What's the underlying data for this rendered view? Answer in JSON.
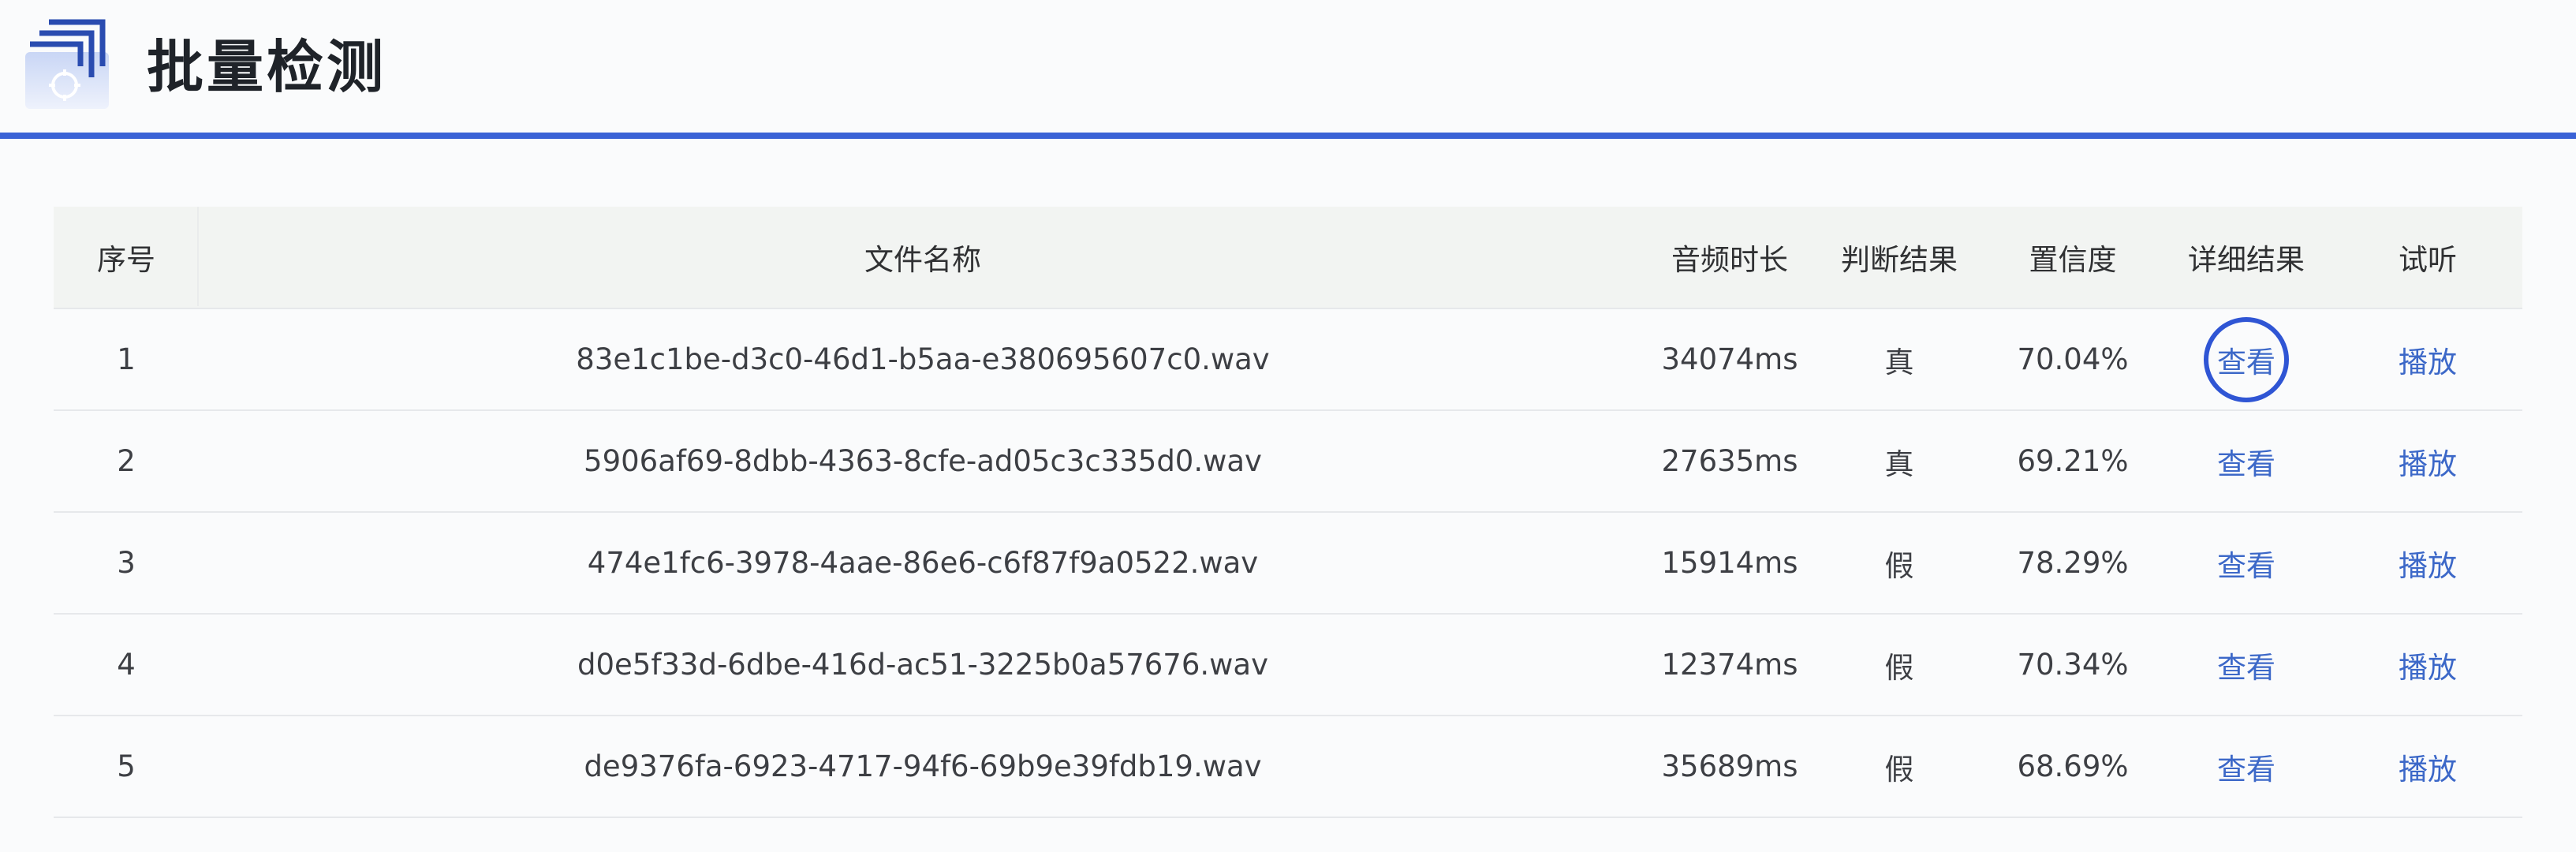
{
  "header": {
    "title": "批量检测",
    "logo_icon": "batch-detect-logo-icon"
  },
  "colors": {
    "accent": "#3a62d6",
    "link": "#3c68c8",
    "header_row_bg": "#f2f4f2"
  },
  "table": {
    "columns": [
      "序号",
      "文件名称",
      "音频时长",
      "判断结果",
      "置信度",
      "详细结果",
      "试听"
    ],
    "rows": [
      {
        "index": "1",
        "filename": "83e1c1be-d3c0-46d1-b5aa-e380695607c0.wav",
        "duration": "34074ms",
        "result": "真",
        "confidence": "70.04%",
        "detail": "查看",
        "play": "播放"
      },
      {
        "index": "2",
        "filename": "5906af69-8dbb-4363-8cfe-ad05c3c335d0.wav",
        "duration": "27635ms",
        "result": "真",
        "confidence": "69.21%",
        "detail": "查看",
        "play": "播放"
      },
      {
        "index": "3",
        "filename": "474e1fc6-3978-4aae-86e6-c6f87f9a0522.wav",
        "duration": "15914ms",
        "result": "假",
        "confidence": "78.29%",
        "detail": "查看",
        "play": "播放"
      },
      {
        "index": "4",
        "filename": "d0e5f33d-6dbe-416d-ac51-3225b0a57676.wav",
        "duration": "12374ms",
        "result": "假",
        "confidence": "70.34%",
        "detail": "查看",
        "play": "播放"
      },
      {
        "index": "5",
        "filename": "de9376fa-6923-4717-94f6-69b9e39fdb19.wav",
        "duration": "35689ms",
        "result": "假",
        "confidence": "68.69%",
        "detail": "查看",
        "play": "播放"
      }
    ]
  }
}
